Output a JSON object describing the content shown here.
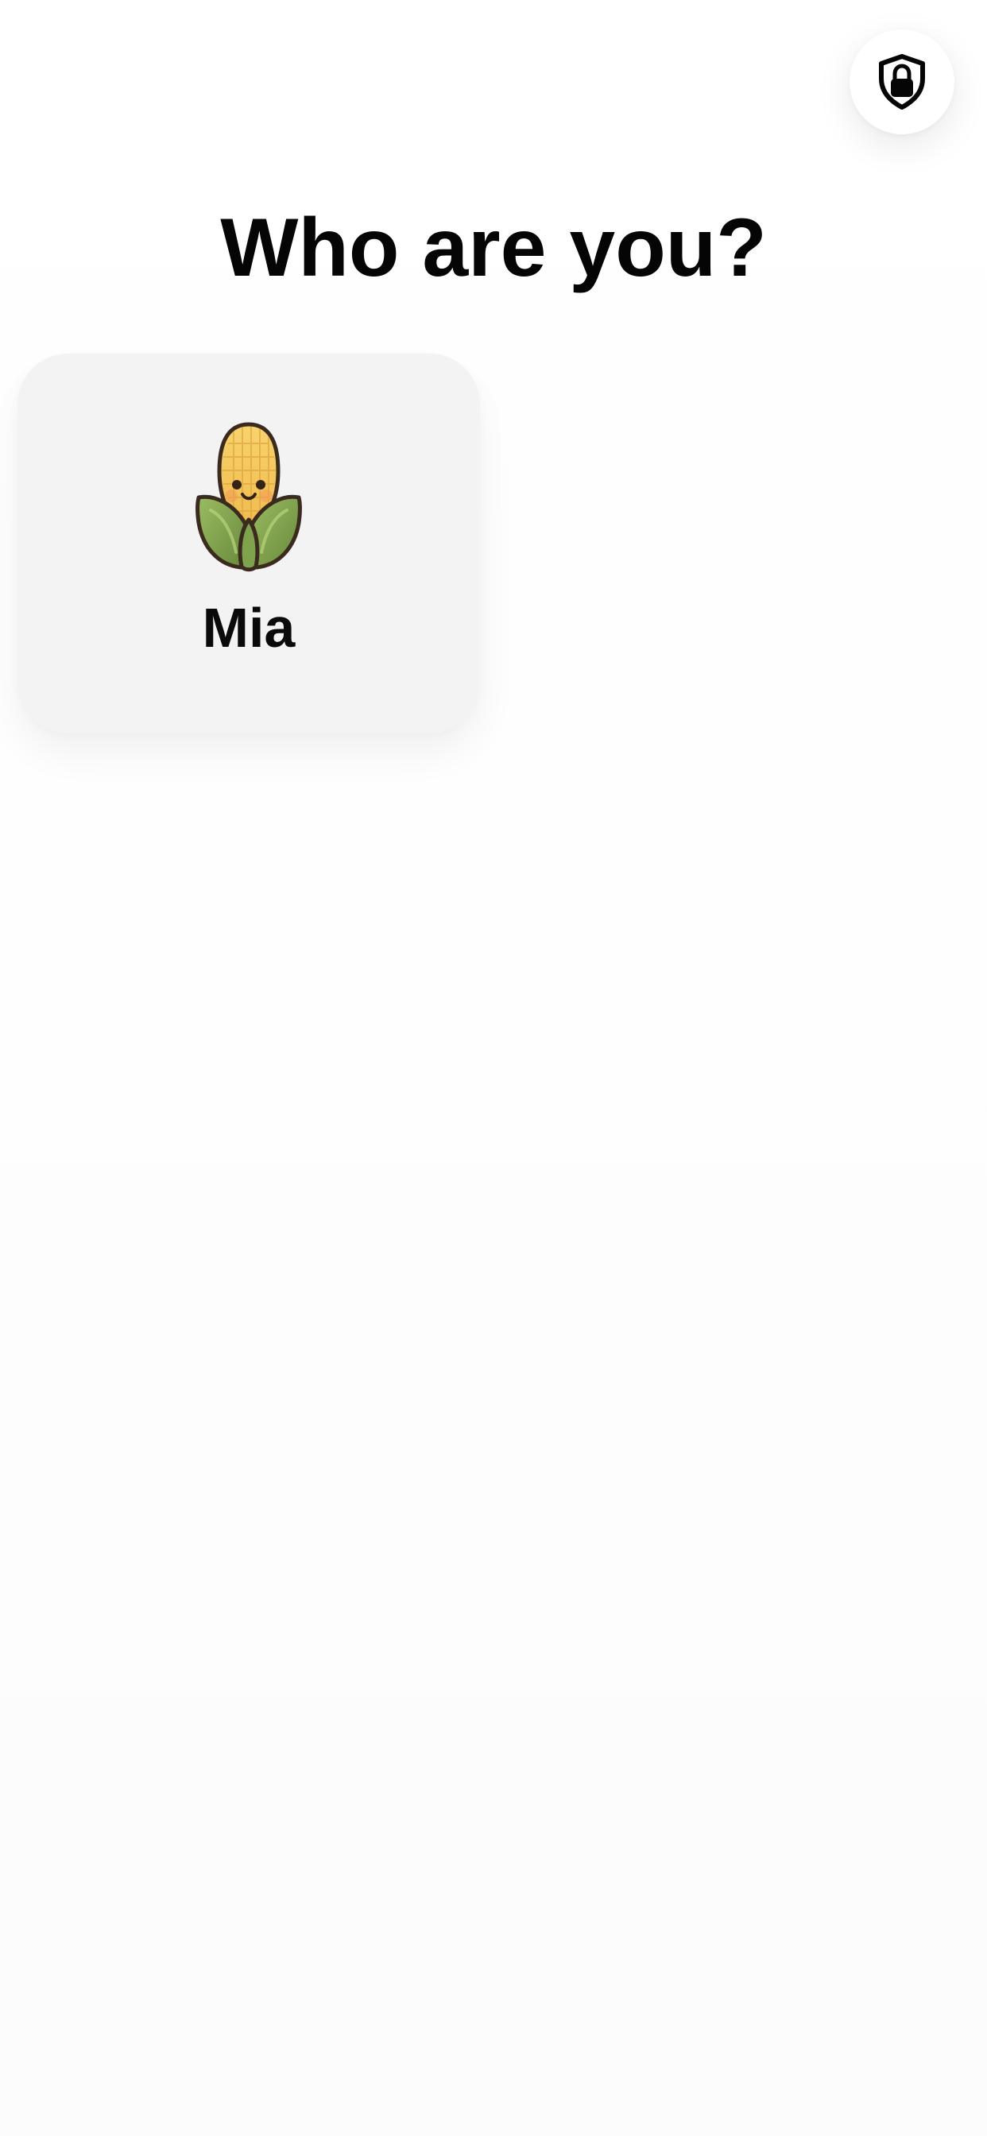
{
  "header": {
    "title": "Who are you?",
    "parent_button_icon": "shield-lock-icon"
  },
  "profiles": [
    {
      "name": "Mia",
      "avatar_icon": "corn-icon",
      "avatar_colors": {
        "kernel": "#f6c85a",
        "husk": "#7fa24d",
        "outline": "#3b2b1f",
        "cheek": "#f2a65a"
      }
    }
  ],
  "colors": {
    "background": "#ffffff",
    "card": "#f3f3f3",
    "text": "#050505"
  }
}
